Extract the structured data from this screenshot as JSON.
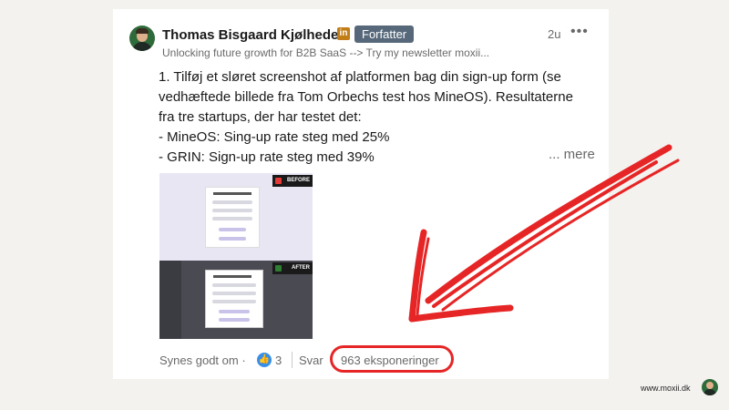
{
  "post": {
    "author_name": "Thomas Bisgaard Kjølhede",
    "linkedin_badge": "in",
    "author_badge": "Forfatter",
    "time": "2u",
    "menu": "•••",
    "subtitle": "Unlocking future growth for B2B SaaS --> Try my newsletter moxii...",
    "body_lines": [
      "1. Tilføj et sløret screenshot af platformen bag din sign-up form (se",
      "vedhæftede billede fra Tom Orbechs test hos MineOS). Resultaterne",
      "fra tre startups, der har testet det:",
      "- MineOS: Sing-up rate steg med 25%",
      "- GRIN: Sign-up rate steg med 39%"
    ],
    "more_label": "... mere",
    "image": {
      "before_tag": "BEFORE",
      "after_tag": "AFTER",
      "before_color": "#e53935",
      "after_color": "#2e7d32"
    },
    "social": {
      "like_label": "Synes godt om",
      "separator": "·",
      "like_icon": "thumbs-up-icon",
      "like_count": "3",
      "reply_label": "Svar",
      "impressions": "963 eksponeringer"
    }
  },
  "footer": {
    "site": "www.moxii.dk"
  },
  "colors": {
    "annotation_red": "#e62626",
    "badge_gray": "#56687a",
    "like_blue": "#378fe9"
  }
}
